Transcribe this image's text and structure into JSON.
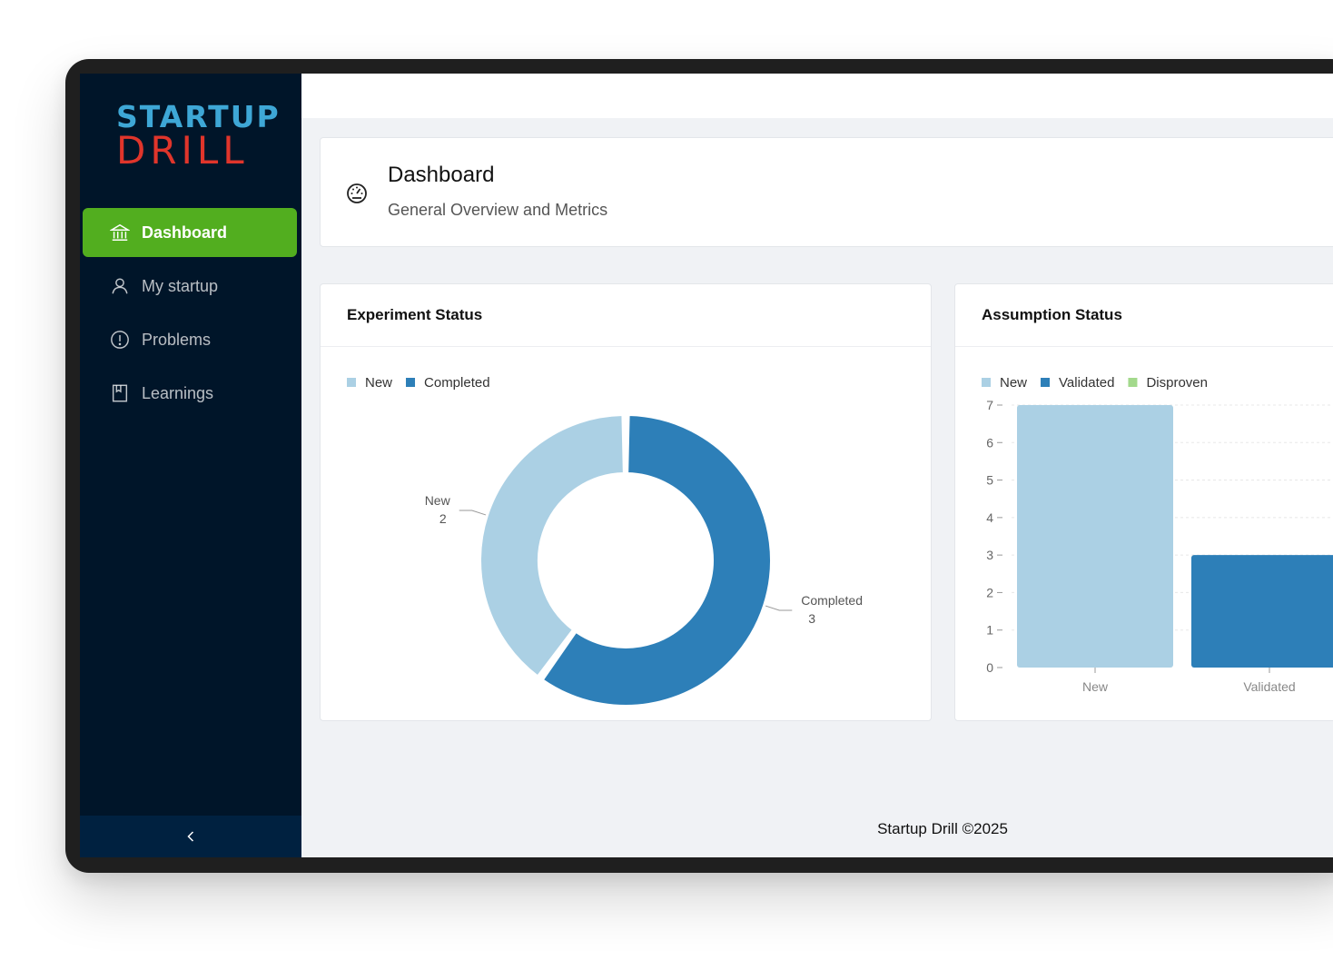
{
  "sidebar": {
    "logo": {
      "line1": "STARTUP",
      "line2": "DRILL"
    },
    "items": [
      {
        "label": "Dashboard",
        "icon": "bank-icon",
        "active": true
      },
      {
        "label": "My startup",
        "icon": "user-icon",
        "active": false
      },
      {
        "label": "Problems",
        "icon": "exclamation-circle-icon",
        "active": false
      },
      {
        "label": "Learnings",
        "icon": "book-icon",
        "active": false
      }
    ],
    "collapse_icon": "chevron-left-icon"
  },
  "page_header": {
    "icon": "gauge-icon",
    "title": "Dashboard",
    "subtitle": "General Overview and Metrics"
  },
  "experiment_card": {
    "title": "Experiment Status"
  },
  "assumption_card": {
    "title": "Assumption Status"
  },
  "colors": {
    "new": "#abd0e4",
    "completed": "#2d7fb8",
    "validated": "#2d7fb8",
    "disproven": "#a3d98c",
    "accent": "#52ae1f",
    "sidebar": "#001529"
  },
  "chart_data": [
    {
      "type": "pie",
      "title": "Experiment Status",
      "legend": [
        "New",
        "Completed"
      ],
      "labels": [
        "New",
        "Completed"
      ],
      "values": [
        2,
        3
      ],
      "colors": [
        "#abd0e4",
        "#2d7fb8"
      ],
      "donut": true,
      "legend_position": "top-left"
    },
    {
      "type": "bar",
      "title": "Assumption Status",
      "legend": [
        "New",
        "Validated",
        "Disproven"
      ],
      "categories": [
        "New",
        "Validated"
      ],
      "values": [
        7,
        3
      ],
      "colors": [
        "#abd0e4",
        "#2d7fb8"
      ],
      "legend_colors": [
        "#abd0e4",
        "#2d7fb8",
        "#a3d98c"
      ],
      "ylim": [
        0,
        7
      ],
      "yticks": [
        0,
        1,
        2,
        3,
        4,
        5,
        6,
        7
      ],
      "grid": true,
      "legend_position": "top-left"
    }
  ],
  "footer": {
    "text": "Startup Drill ©2025"
  }
}
